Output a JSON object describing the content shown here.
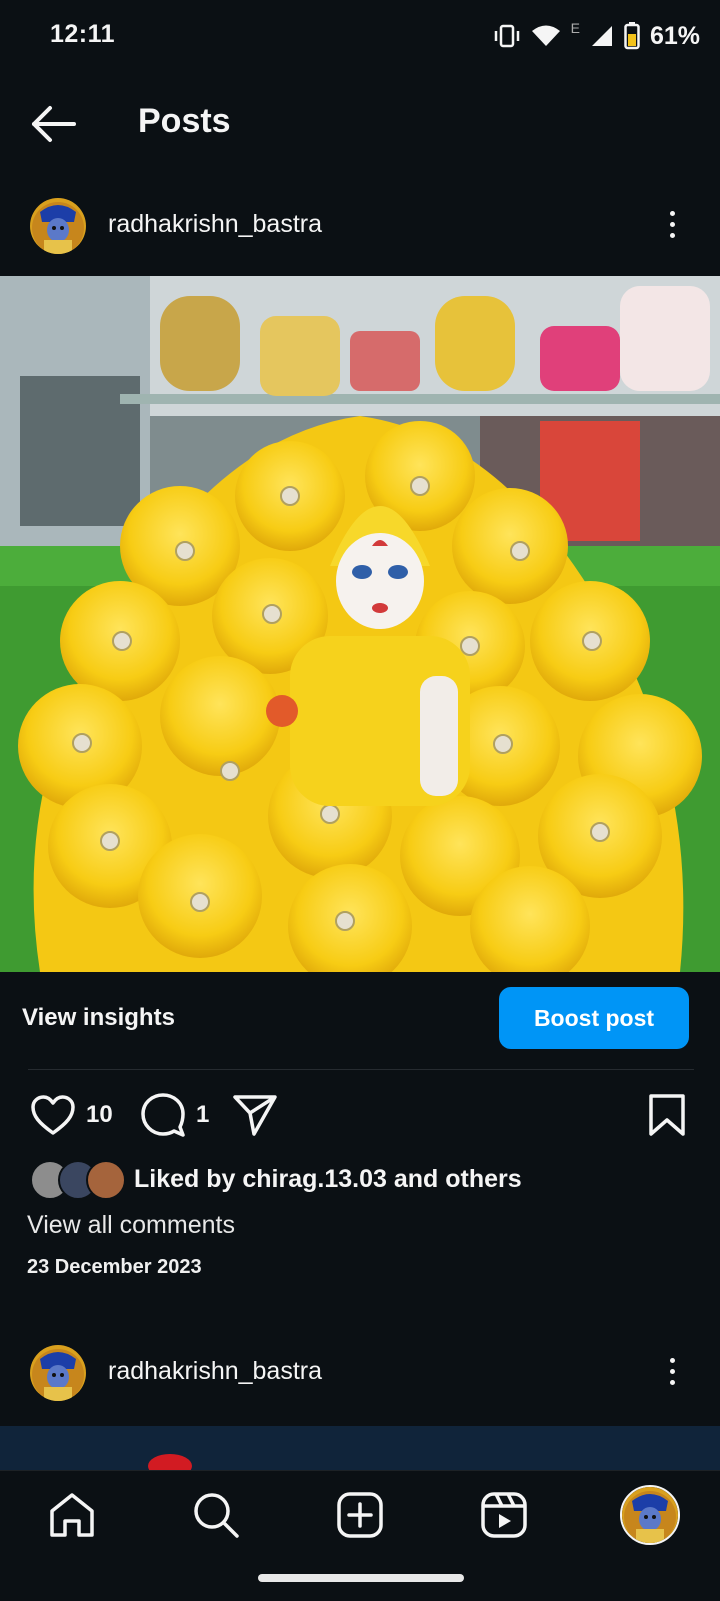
{
  "status_bar": {
    "time": "12:11",
    "network_label": "E",
    "battery_percent": "61%",
    "icons": [
      "vibrate-icon",
      "wifi-icon",
      "signal-icon",
      "battery-icon"
    ]
  },
  "header": {
    "title": "Posts",
    "back_icon": "arrow-left-icon"
  },
  "posts": [
    {
      "username": "radhakrishn_bastra",
      "view_insights_label": "View insights",
      "boost_label": "Boost post",
      "like_count": "10",
      "comment_count": "1",
      "liked_by_prefix": "Liked by ",
      "liked_by_user": "chirag.13.03",
      "liked_by_suffix": " and others",
      "view_comments_label": "View all comments",
      "date": "23 December 2023"
    },
    {
      "username": "radhakrishn_bastra"
    }
  ],
  "nav": {
    "items": [
      "home-icon",
      "search-icon",
      "create-icon",
      "reels-icon",
      "profile-avatar"
    ]
  },
  "colors": {
    "background": "#0b1014",
    "accent": "#0095f6",
    "text": "#f5f5f5"
  }
}
